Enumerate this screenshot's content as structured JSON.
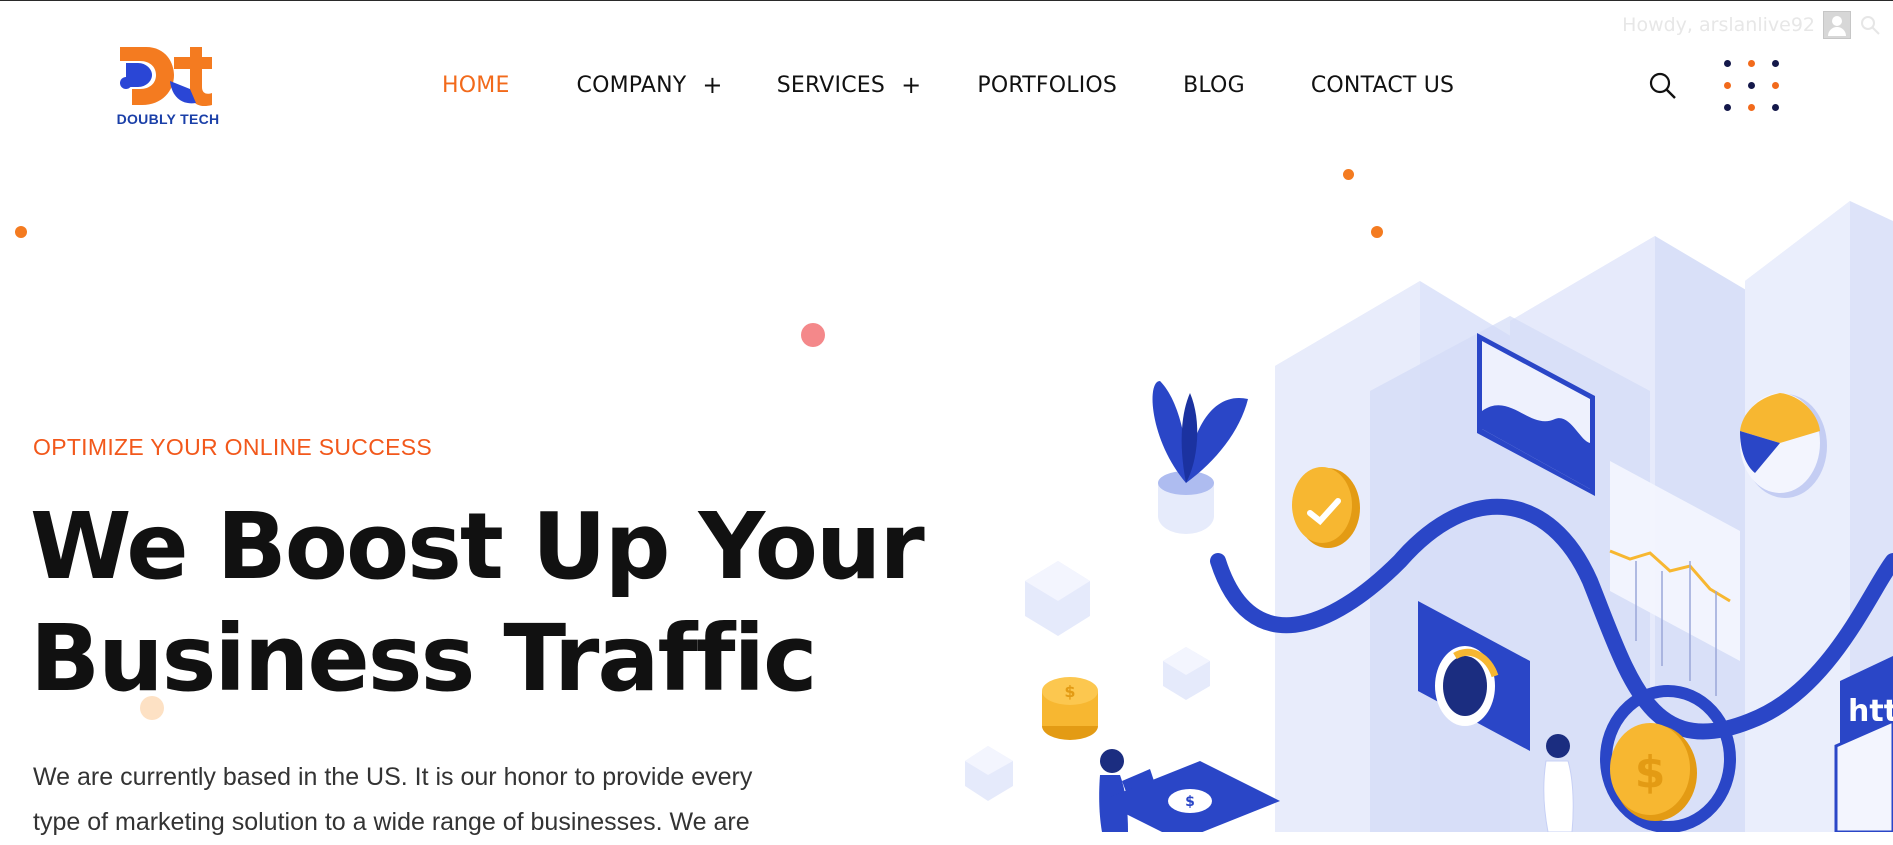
{
  "admin_bar": {
    "greeting": "Howdy, arslanlive92"
  },
  "logo": {
    "text": "DOUBLY TECH"
  },
  "nav": {
    "items": [
      {
        "label": "HOME",
        "active": true,
        "has_submenu": false
      },
      {
        "label": "COMPANY",
        "active": false,
        "has_submenu": true
      },
      {
        "label": "SERVICES",
        "active": false,
        "has_submenu": true
      },
      {
        "label": "PORTFOLIOS",
        "active": false,
        "has_submenu": false
      },
      {
        "label": "BLOG",
        "active": false,
        "has_submenu": false
      },
      {
        "label": "CONTACT US",
        "active": false,
        "has_submenu": false
      }
    ],
    "submenu_symbol": "+"
  },
  "hero": {
    "kicker": "OPTIMIZE YOUR ONLINE SUCCESS",
    "headline_line1": "We Boost Up Your",
    "headline_line2": "Business Traffic",
    "paragraph_line1": "We are currently based in the US. It is our honor to provide every",
    "paragraph_line2": "type of marketing solution to a wide range of businesses. We are"
  },
  "illustration": {
    "url_fragment": "htt",
    "coin_symbol": "$"
  },
  "colors": {
    "accent": "#f26a1b",
    "brand_blue": "#2340c9",
    "text": "#111111",
    "illustration_bg": "#e8ecfb",
    "coin": "#f7b731"
  }
}
